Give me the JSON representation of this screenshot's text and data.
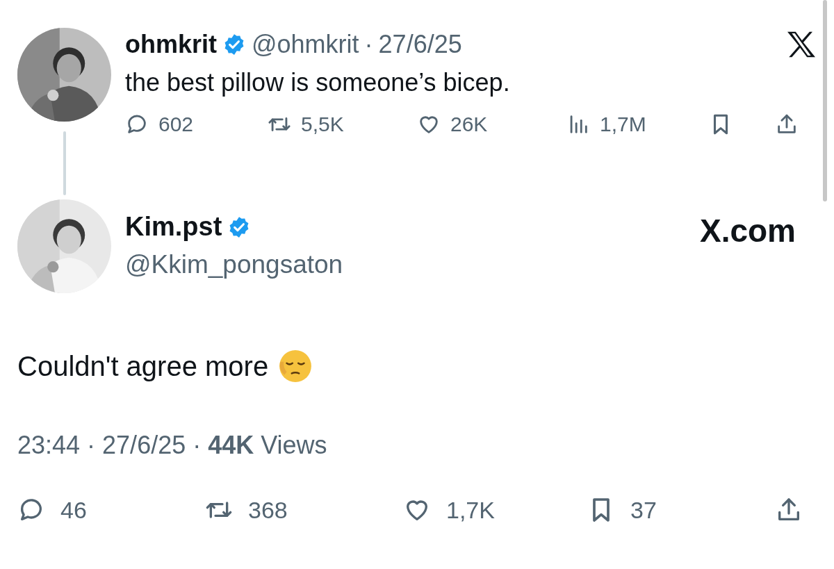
{
  "tweet": {
    "author": {
      "name": "ohmkrit",
      "handle": "@ohmkrit",
      "verified": true
    },
    "separator": "·",
    "date": "27/6/25",
    "text": "the best pillow is someone’s bicep.",
    "actions": [
      {
        "kind": "reply",
        "count": "602"
      },
      {
        "kind": "repost",
        "count": "5,5K"
      },
      {
        "kind": "like",
        "count": "26K"
      },
      {
        "kind": "views",
        "count": "1,7M"
      },
      {
        "kind": "bookmark"
      },
      {
        "kind": "share"
      }
    ]
  },
  "reply": {
    "author": {
      "name": "Kim.pst",
      "handle": "@Kkim_pongsaton",
      "verified": true
    },
    "source": "X.com",
    "text": "Couldn't agree more",
    "meta": "23:44 · 27/6/25 · **44K** Views",
    "actions": [
      {
        "kind": "reply",
        "count": "46"
      },
      {
        "kind": "repost",
        "count": "368"
      },
      {
        "kind": "like",
        "count": "1,7K"
      },
      {
        "kind": "bookmark",
        "count": "37"
      },
      {
        "kind": "share"
      }
    ]
  }
}
